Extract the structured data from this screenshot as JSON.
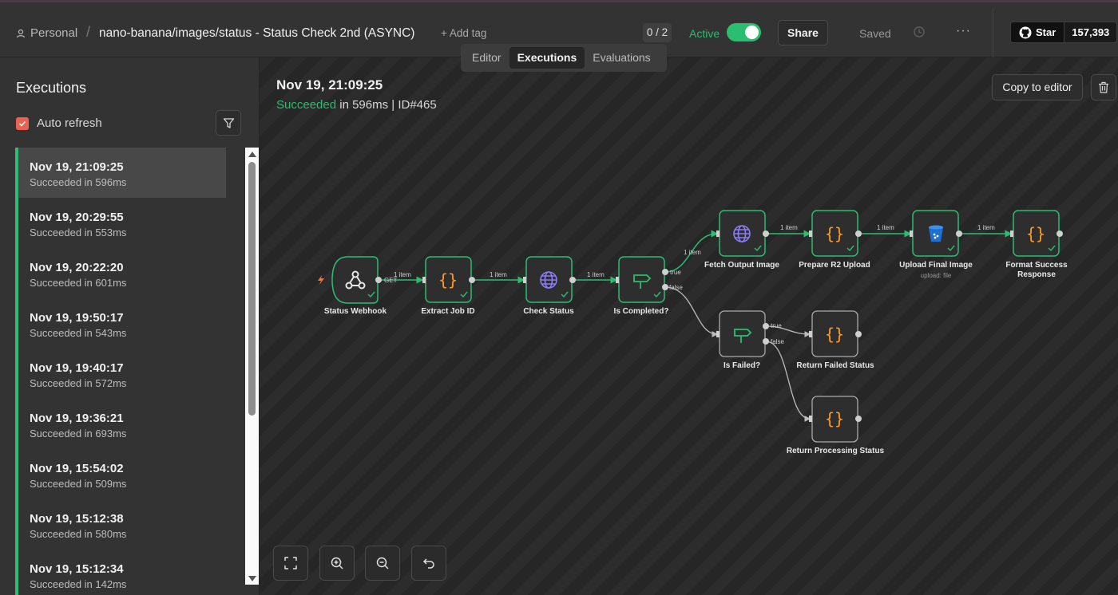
{
  "header": {
    "workspace": "Personal",
    "separator": "/",
    "workflow_title": "nano-banana/images/status - Status Check 2nd (ASYNC)",
    "add_tag": "+ Add tag",
    "counter": "0 / 2",
    "active_label": "Active",
    "share_label": "Share",
    "saved_label": "Saved",
    "more_label": "···",
    "github_star": "Star",
    "github_count": "157,393"
  },
  "tabs": [
    {
      "label": "Editor",
      "active": false
    },
    {
      "label": "Executions",
      "active": true
    },
    {
      "label": "Evaluations",
      "active": false
    }
  ],
  "sidebar": {
    "title": "Executions",
    "auto_refresh_label": "Auto refresh",
    "auto_refresh_checked": true,
    "executions": [
      {
        "date": "Nov 19, 21:09:25",
        "status": "Succeeded in 596ms",
        "selected": true
      },
      {
        "date": "Nov 19, 20:29:55",
        "status": "Succeeded in 553ms",
        "selected": false
      },
      {
        "date": "Nov 19, 20:22:20",
        "status": "Succeeded in 601ms",
        "selected": false
      },
      {
        "date": "Nov 19, 19:50:17",
        "status": "Succeeded in 543ms",
        "selected": false
      },
      {
        "date": "Nov 19, 19:40:17",
        "status": "Succeeded in 572ms",
        "selected": false
      },
      {
        "date": "Nov 19, 19:36:21",
        "status": "Succeeded in 693ms",
        "selected": false
      },
      {
        "date": "Nov 19, 15:54:02",
        "status": "Succeeded in 509ms",
        "selected": false
      },
      {
        "date": "Nov 19, 15:12:38",
        "status": "Succeeded in 580ms",
        "selected": false
      },
      {
        "date": "Nov 19, 15:12:34",
        "status": "Succeeded in 142ms",
        "selected": false
      }
    ]
  },
  "run": {
    "date": "Nov 19, 21:09:25",
    "status_word": "Succeeded",
    "status_rest": " in 596ms | ID#465",
    "copy_label": "Copy to editor"
  },
  "workflow": {
    "nodes": {
      "status_webhook": {
        "label": "Status Webhook",
        "icon": "webhook-icon",
        "method": "GET"
      },
      "extract_job_id": {
        "label": "Extract Job ID",
        "icon": "code-braces-icon"
      },
      "check_status": {
        "label": "Check Status",
        "icon": "globe-icon"
      },
      "is_completed": {
        "label": "Is Completed?",
        "icon": "signpost-icon"
      },
      "fetch_output_image": {
        "label": "Fetch Output Image",
        "icon": "globe-icon"
      },
      "prepare_r2_upload": {
        "label": "Prepare R2 Upload",
        "icon": "code-braces-icon"
      },
      "upload_final_image": {
        "label": "Upload Final Image",
        "icon": "bucket-icon",
        "subtitle": "upload: file"
      },
      "format_success_line1": "Format Success",
      "format_success_line2": "Response",
      "is_failed": {
        "label": "Is Failed?",
        "icon": "signpost-icon"
      },
      "return_failed_status": {
        "label": "Return Failed Status",
        "icon": "code-braces-icon"
      },
      "return_processing_status": {
        "label": "Return Processing Status",
        "icon": "code-braces-icon"
      }
    },
    "edge_item_label": "1 item",
    "branch_true": "true",
    "branch_false": "false",
    "colors": {
      "success": "#2bbd70",
      "code": "#ff9922",
      "globe": "#8b7cf6",
      "node_bg": "#2e2e2e",
      "node_border_ok": "#2bbd70",
      "node_border": "#aaaaaa",
      "bucket": "#1e6fd0"
    }
  }
}
